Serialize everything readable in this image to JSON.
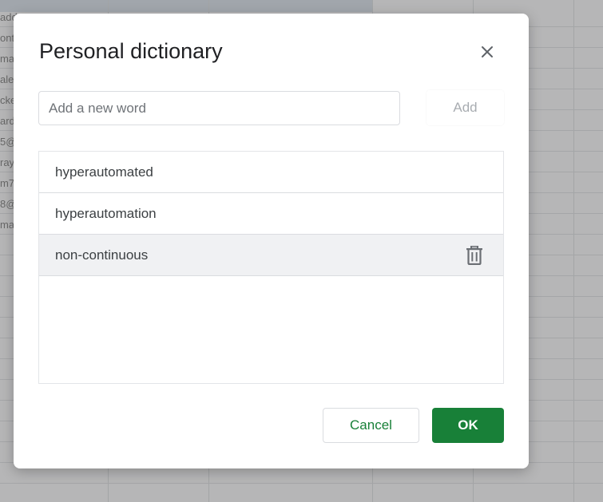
{
  "background": {
    "visible_cell_fragments": [
      "add",
      "ont",
      "ma",
      "ale",
      "cke",
      "ard",
      "5@",
      "ray",
      "m7",
      "8@",
      "mar"
    ]
  },
  "dialog": {
    "title": "Personal dictionary",
    "close_icon": "close-icon",
    "input": {
      "placeholder": "Add a new word",
      "value": ""
    },
    "add_label": "Add",
    "words": [
      {
        "text": "hyperautomated",
        "hovered": false
      },
      {
        "text": "hyperautomation",
        "hovered": false
      },
      {
        "text": "non-continuous",
        "hovered": true
      }
    ],
    "delete_icon": "trash-icon",
    "cancel_label": "Cancel",
    "ok_label": "OK"
  },
  "colors": {
    "primary_green": "#188038",
    "disabled_text": "#a8acb1",
    "hover_row": "#f0f1f3"
  }
}
